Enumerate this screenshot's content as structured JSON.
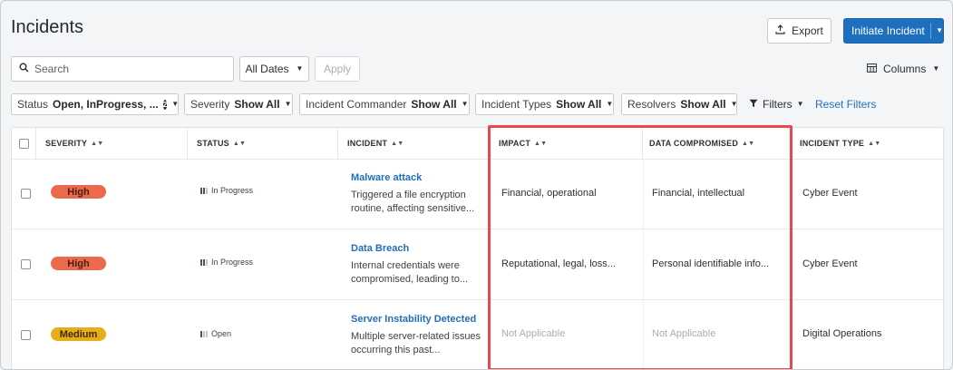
{
  "page": {
    "title": "Incidents"
  },
  "header": {
    "export_label": "Export",
    "initiate_label": "Initiate Incident"
  },
  "search": {
    "placeholder": "Search",
    "value": ""
  },
  "dates": {
    "label": "All Dates"
  },
  "apply_label": "Apply",
  "columns_label": "Columns",
  "filters": [
    {
      "name": "Status",
      "value": "Open, InProgress, ...",
      "badge": "2"
    },
    {
      "name": "Severity",
      "value": "Show All"
    },
    {
      "name": "Incident Commander",
      "value": "Show All"
    },
    {
      "name": "Incident Types",
      "value": "Show All"
    },
    {
      "name": "Resolvers",
      "value": "Show All"
    }
  ],
  "filters_menu_label": "Filters",
  "reset_filters_label": "Reset Filters",
  "table": {
    "headers": {
      "severity": "SEVERITY",
      "status": "STATUS",
      "incident": "INCIDENT",
      "impact": "IMPACT",
      "data_compromised": "DATA COMPROMISED",
      "incident_type": "INCIDENT TYPE"
    },
    "rows": [
      {
        "severity": "High",
        "status": "In Progress",
        "title": "Malware attack",
        "description": "Triggered a file encryption routine, affecting sensitive...",
        "impact": "Financial, operational",
        "data_compromised": "Financial, intellectual",
        "incident_type": "Cyber Event"
      },
      {
        "severity": "High",
        "status": "In Progress",
        "title": "Data Breach",
        "description": "Internal credentials were compromised, leading to...",
        "impact": "Reputational, legal, loss...",
        "data_compromised": "Personal identifiable info...",
        "incident_type": "Cyber Event"
      },
      {
        "severity": "Medium",
        "status": "Open",
        "title": "Server Instability Detected",
        "description": "Multiple server-related issues occurring this past...",
        "impact": "Not Applicable",
        "data_compromised": "Not Applicable",
        "incident_type": "Digital Operations"
      }
    ]
  },
  "colors": {
    "high": "#ec6a4c",
    "medium": "#e8ad19",
    "accent": "#1f6fbf",
    "highlight": "#e8484f"
  },
  "icons": {
    "export": "upload-icon",
    "search": "search-icon",
    "columns": "columns-grid-icon",
    "filters": "funnel-icon",
    "caret": "caret-down-icon",
    "sort": "sort-arrows-icon"
  }
}
